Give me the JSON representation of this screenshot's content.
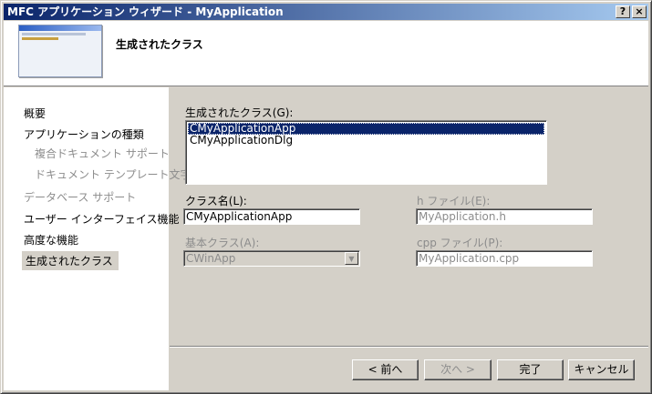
{
  "window": {
    "title": "MFC アプリケーション ウィザード - MyApplication",
    "help_label": "?",
    "close_label": "×"
  },
  "header": {
    "title": "生成されたクラス"
  },
  "sidebar": {
    "items": [
      {
        "label": "概要",
        "state": "normal"
      },
      {
        "label": "アプリケーションの種類",
        "state": "normal"
      },
      {
        "label": "複合ドキュメント サポート",
        "state": "disabled"
      },
      {
        "label": "ドキュメント テンプレート文字列",
        "state": "disabled"
      },
      {
        "label": "データベース サポート",
        "state": "disabled"
      },
      {
        "label": "ユーザー インターフェイス機能",
        "state": "normal"
      },
      {
        "label": "高度な機能",
        "state": "normal"
      },
      {
        "label": "生成されたクラス",
        "state": "selected"
      }
    ]
  },
  "main": {
    "classes_label": "生成されたクラス(G):",
    "classes": [
      {
        "name": "CMyApplicationApp",
        "selected": true
      },
      {
        "name": "CMyApplicationDlg",
        "selected": false
      }
    ],
    "class_name_label": "クラス名(L):",
    "class_name_value": "CMyApplicationApp",
    "h_file_label": "h ファイル(E):",
    "h_file_value": "MyApplication.h",
    "base_class_label": "基本クラス(A):",
    "base_class_value": "CWinApp",
    "cpp_file_label": "cpp ファイル(P):",
    "cpp_file_value": "MyApplication.cpp"
  },
  "buttons": {
    "back": "< 前へ",
    "next": "次へ >",
    "finish": "完了",
    "cancel": "キャンセル"
  }
}
